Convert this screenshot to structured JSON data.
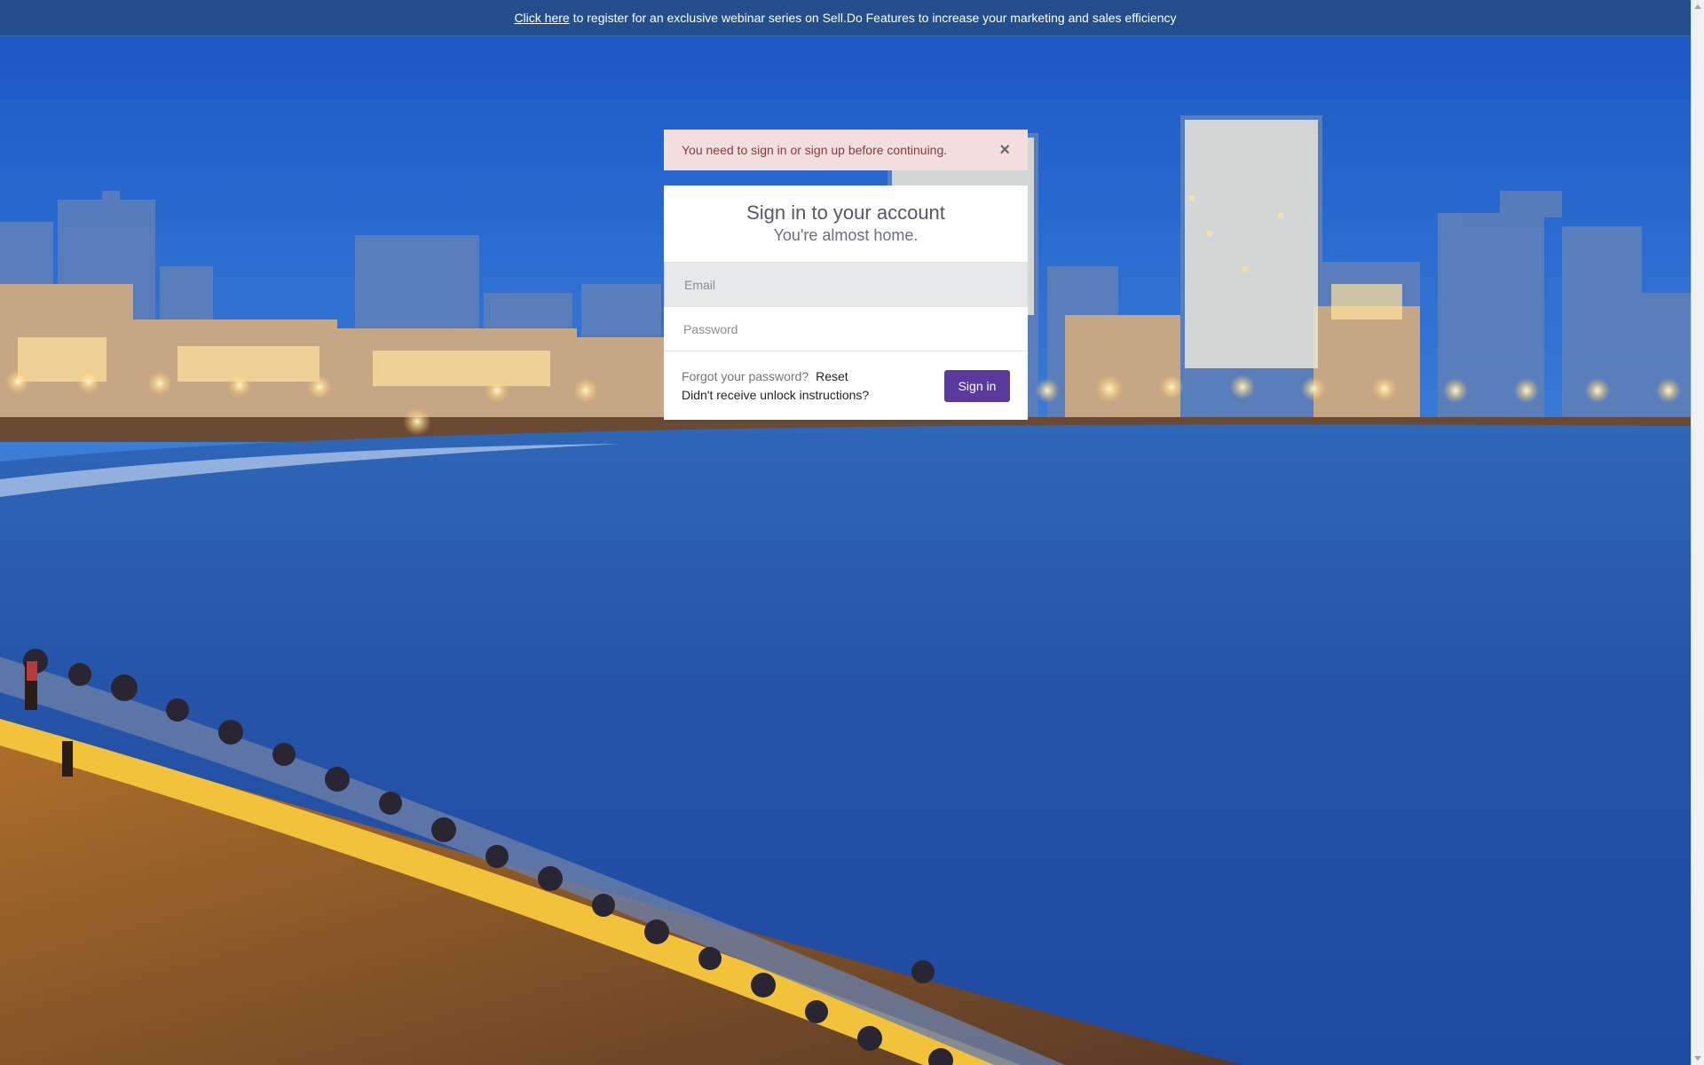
{
  "banner": {
    "link_text": "Click here",
    "message": "to register for an exclusive webinar series on Sell.Do Features to increase your marketing and sales efficiency"
  },
  "alert": {
    "message": "You need to sign in or sign up before continuing.",
    "close_label": "×"
  },
  "login": {
    "title": "Sign in to your account",
    "subtitle": "You're almost home.",
    "email_placeholder": "Email",
    "password_placeholder": "Password",
    "forgot_text": "Forgot your password?",
    "reset_label": "Reset",
    "unlock_label": "Didn't receive unlock instructions?",
    "signin_label": "Sign in"
  },
  "colors": {
    "banner": "#234f8d",
    "alert_bg": "#f2dedf",
    "signin_button": "#5b3a9e",
    "sky": "#1d54b8"
  }
}
